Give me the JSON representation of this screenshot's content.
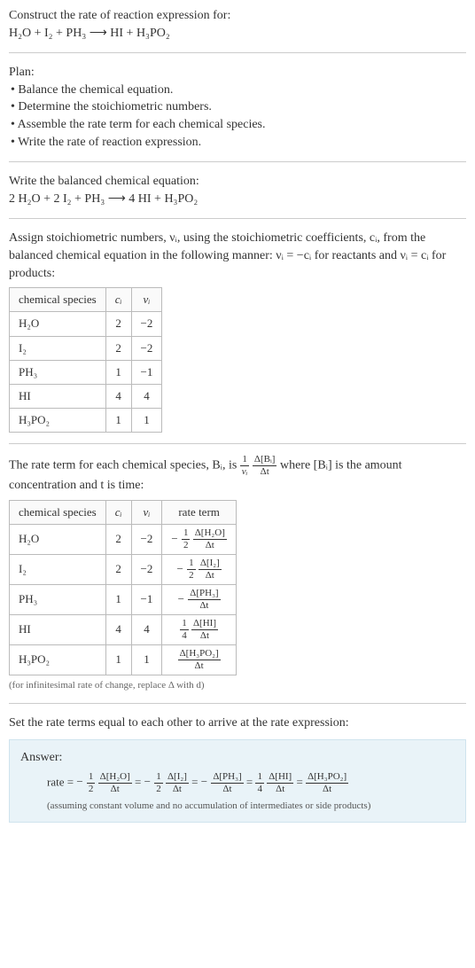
{
  "header": {
    "title": "Construct the rate of reaction expression for:",
    "equation": "H₂O + I₂ + PH₃  ⟶  HI + H₃PO₂"
  },
  "plan": {
    "title": "Plan:",
    "items": [
      "• Balance the chemical equation.",
      "• Determine the stoichiometric numbers.",
      "• Assemble the rate term for each chemical species.",
      "• Write the rate of reaction expression."
    ]
  },
  "balanced": {
    "title": "Write the balanced chemical equation:",
    "equation": "2 H₂O + 2 I₂ + PH₃  ⟶  4 HI + H₃PO₂"
  },
  "stoich_intro": "Assign stoichiometric numbers, νᵢ, using the stoichiometric coefficients, cᵢ, from the balanced chemical equation in the following manner: νᵢ = −cᵢ for reactants and νᵢ = cᵢ for products:",
  "table1": {
    "headers": [
      "chemical species",
      "cᵢ",
      "νᵢ"
    ],
    "rows": [
      {
        "sp": "H₂O",
        "c": "2",
        "v": "−2"
      },
      {
        "sp": "I₂",
        "c": "2",
        "v": "−2"
      },
      {
        "sp": "PH₃",
        "c": "1",
        "v": "−1"
      },
      {
        "sp": "HI",
        "c": "4",
        "v": "4"
      },
      {
        "sp": "H₃PO₂",
        "c": "1",
        "v": "1"
      }
    ]
  },
  "rateterm_intro_1": "The rate term for each chemical species, Bᵢ, is ",
  "rateterm_frac1_num": "1",
  "rateterm_frac1_den": "νᵢ",
  "rateterm_frac2_num": "Δ[Bᵢ]",
  "rateterm_frac2_den": "Δt",
  "rateterm_intro_2": " where [Bᵢ] is the amount concentration and t is time:",
  "table2": {
    "headers": [
      "chemical species",
      "cᵢ",
      "νᵢ",
      "rate term"
    ],
    "rows": [
      {
        "sp": "H₂O",
        "c": "2",
        "v": "−2",
        "sign": "−",
        "coef_num": "1",
        "coef_den": "2",
        "d_num": "Δ[H₂O]",
        "d_den": "Δt"
      },
      {
        "sp": "I₂",
        "c": "2",
        "v": "−2",
        "sign": "−",
        "coef_num": "1",
        "coef_den": "2",
        "d_num": "Δ[I₂]",
        "d_den": "Δt"
      },
      {
        "sp": "PH₃",
        "c": "1",
        "v": "−1",
        "sign": "−",
        "coef_num": "",
        "coef_den": "",
        "d_num": "Δ[PH₃]",
        "d_den": "Δt"
      },
      {
        "sp": "HI",
        "c": "4",
        "v": "4",
        "sign": "",
        "coef_num": "1",
        "coef_den": "4",
        "d_num": "Δ[HI]",
        "d_den": "Δt"
      },
      {
        "sp": "H₃PO₂",
        "c": "1",
        "v": "1",
        "sign": "",
        "coef_num": "",
        "coef_den": "",
        "d_num": "Δ[H₃PO₂]",
        "d_den": "Δt"
      }
    ]
  },
  "table2_note": "(for infinitesimal rate of change, replace Δ with d)",
  "final_intro": "Set the rate terms equal to each other to arrive at the rate expression:",
  "answer": {
    "title": "Answer:",
    "prefix": "rate = ",
    "terms": [
      {
        "sign": "−",
        "coef_num": "1",
        "coef_den": "2",
        "d_num": "Δ[H₂O]",
        "d_den": "Δt"
      },
      {
        "sign": "−",
        "coef_num": "1",
        "coef_den": "2",
        "d_num": "Δ[I₂]",
        "d_den": "Δt"
      },
      {
        "sign": "−",
        "coef_num": "",
        "coef_den": "",
        "d_num": "Δ[PH₃]",
        "d_den": "Δt"
      },
      {
        "sign": "",
        "coef_num": "1",
        "coef_den": "4",
        "d_num": "Δ[HI]",
        "d_den": "Δt"
      },
      {
        "sign": "",
        "coef_num": "",
        "coef_den": "",
        "d_num": "Δ[H₃PO₂]",
        "d_den": "Δt"
      }
    ],
    "note": "(assuming constant volume and no accumulation of intermediates or side products)"
  }
}
